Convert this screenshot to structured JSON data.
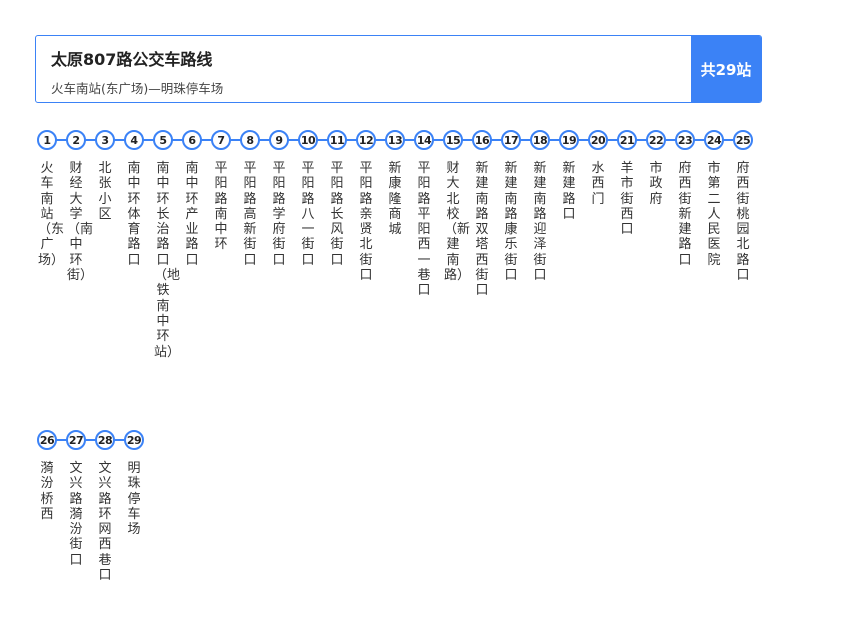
{
  "header": {
    "title": "太原807路公交车路线",
    "subtitle": "火车南站(东广场)—明珠停车场",
    "total": "共29站"
  },
  "rows": [
    {
      "stops": [
        {
          "number": "1",
          "name": "火车南站（东广场）"
        },
        {
          "number": "2",
          "name": "财经大学（南中环街）"
        },
        {
          "number": "3",
          "name": "北张小区"
        },
        {
          "number": "4",
          "name": "南中环体育路口"
        },
        {
          "number": "5",
          "name": "南中环长治路口（地铁南中环站）"
        },
        {
          "number": "6",
          "name": "南中环产业路口"
        },
        {
          "number": "7",
          "name": "平阳路南中环"
        },
        {
          "number": "8",
          "name": "平阳路高新街口"
        },
        {
          "number": "9",
          "name": "平阳路学府街口"
        },
        {
          "number": "10",
          "name": "平阳路八一街口"
        },
        {
          "number": "11",
          "name": "平阳路长风街口"
        },
        {
          "number": "12",
          "name": "平阳路亲贤北街口"
        },
        {
          "number": "13",
          "name": "新康隆商城"
        },
        {
          "number": "14",
          "name": "平阳路平阳西一巷口"
        },
        {
          "number": "15",
          "name": "财大北校（新建南路）"
        },
        {
          "number": "16",
          "name": "新建南路双塔西街口"
        },
        {
          "number": "17",
          "name": "新建南路康乐街口"
        },
        {
          "number": "18",
          "name": "新建南路迎泽街口"
        },
        {
          "number": "19",
          "name": "新建路口"
        },
        {
          "number": "20",
          "name": "水西门"
        },
        {
          "number": "21",
          "name": "羊市街西口"
        },
        {
          "number": "22",
          "name": "市政府"
        },
        {
          "number": "23",
          "name": "府西街新建路口"
        },
        {
          "number": "24",
          "name": "市第二人民医院"
        },
        {
          "number": "25",
          "name": "府西街桃园北路口"
        }
      ]
    },
    {
      "stops": [
        {
          "number": "26",
          "name": "漪汾桥西"
        },
        {
          "number": "27",
          "name": "文兴路漪汾街口"
        },
        {
          "number": "28",
          "name": "文兴路环网西巷口"
        },
        {
          "number": "29",
          "name": "明珠停车场"
        }
      ]
    }
  ]
}
